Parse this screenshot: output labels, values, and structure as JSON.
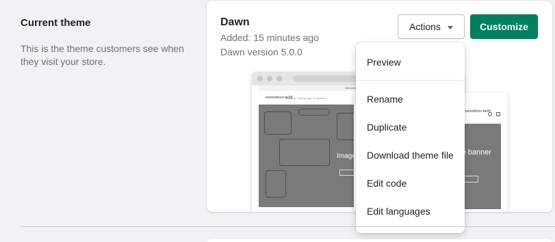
{
  "section": {
    "title": "Current theme",
    "description": "This is the theme customers see when they visit your store."
  },
  "theme": {
    "name": "Dawn",
    "added": "Added: 15 minutes ago",
    "version": "Dawn version 5.0.0"
  },
  "buttons": {
    "actions": "Actions",
    "customize": "Customize"
  },
  "actions_menu": {
    "items": [
      "Preview",
      "Rename",
      "Duplicate",
      "Download theme file",
      "Edit code",
      "Edit languages"
    ]
  },
  "preview": {
    "announcement": "Welcome to our store",
    "store_name": "everestfuvxr.be05",
    "nav": "Home   Catalog   Contact",
    "banner_title": "Image banner",
    "mobile_announcement": "Welcome to our store",
    "mobile_store_name": "everestfuvxr-be05",
    "mobile_banner_title": "Image banner"
  },
  "colors": {
    "primary": "#008060",
    "background": "#f1f2f3"
  }
}
